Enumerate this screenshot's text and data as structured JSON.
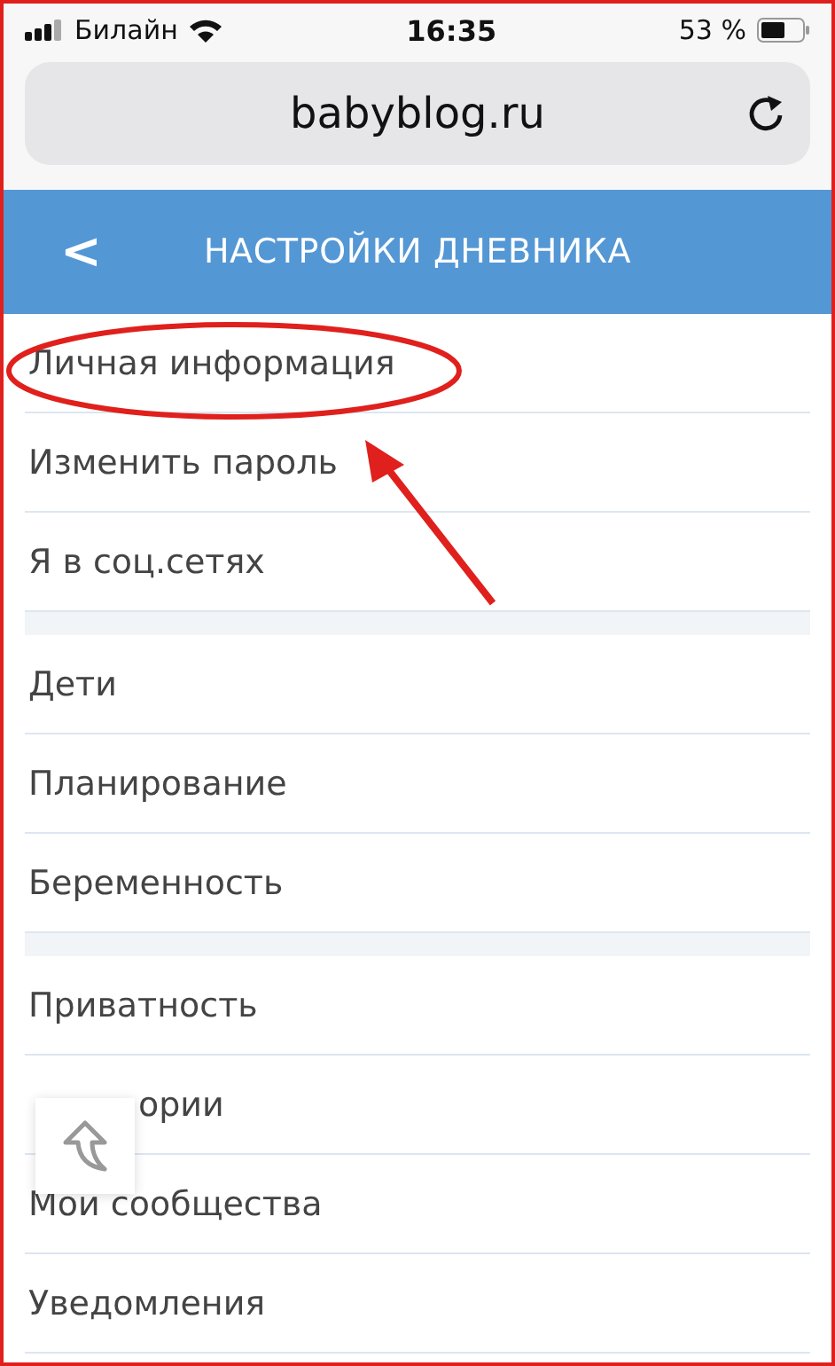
{
  "status_bar": {
    "carrier": "Билайн",
    "time": "16:35",
    "battery": "53 %"
  },
  "address_bar": {
    "url": "babyblog.ru"
  },
  "header": {
    "back": "<",
    "title": "НАСТРОЙКИ ДНЕВНИКА"
  },
  "groups": [
    {
      "items": [
        {
          "label": "Личная информация",
          "circled": true
        },
        {
          "label": "Изменить пароль",
          "circled": false
        },
        {
          "label": "Я в соц.сетях",
          "circled": false
        }
      ]
    },
    {
      "items": [
        {
          "label": "Дети",
          "circled": false
        },
        {
          "label": "Планирование",
          "circled": false
        },
        {
          "label": "Беременность",
          "circled": false
        }
      ]
    },
    {
      "items": [
        {
          "label": "Приватность",
          "circled": false
        },
        {
          "label": "ории",
          "covered": true,
          "circled": false
        },
        {
          "label": "Мои сообщества",
          "circled": false
        },
        {
          "label": "Уведомления",
          "circled": false
        }
      ]
    }
  ],
  "scroll_top_button": {
    "visible": true
  }
}
